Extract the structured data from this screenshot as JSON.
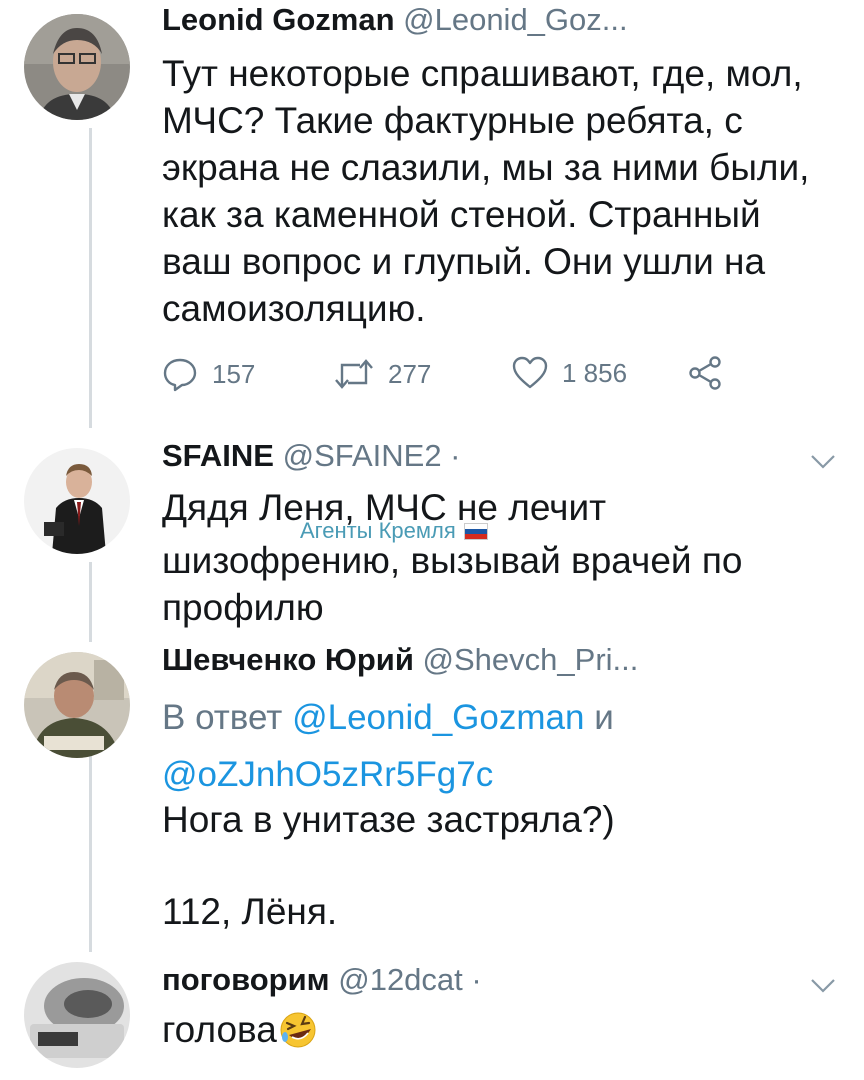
{
  "tweets": [
    {
      "name": "Leonid Gozman",
      "handle": "@Leonid_Goz...",
      "text_lines": [
        "Тут некоторые спрашивают, где, мол,",
        "МЧС? Такие фактурные ребята, с",
        "экрана не слазили, мы за ними были,",
        "как за каменной стеной. Странный",
        "ваш вопрос и глупый. Они ушли на",
        "самоизоляцию."
      ],
      "actions": {
        "replies": "157",
        "retweets": "277",
        "likes": "1 856"
      }
    },
    {
      "name": "SFAINE",
      "handle": "@SFAINE2 ·",
      "text_lines": [
        "Дядя Леня, МЧС не лечит",
        "шизофрению, вызывай врачей по",
        "профилю"
      ]
    },
    {
      "name": "Шевченко Юрий",
      "handle": "@Shevch_Pri...",
      "reply_prefix": "В ответ",
      "reply_mention_1": "@Leonid_Gozman",
      "reply_and": "и",
      "reply_mention_2": "@oZJnhO5zRr5Fg7c",
      "text_line_1": "Нога в унитазе застряла?)",
      "text_line_2": "112, Лёня."
    },
    {
      "name": "поговорим",
      "handle": "@12dcat ·",
      "text": "голова",
      "emoji": "rolling-on-floor-laughing-emoji"
    }
  ],
  "watermark": {
    "text": "Агенты Кремля",
    "icon": "russian-flag-icon"
  },
  "colors": {
    "text": "#14171a",
    "secondary": "#657786",
    "mention": "#1b95e0",
    "thread_line": "#d6dbdf"
  }
}
